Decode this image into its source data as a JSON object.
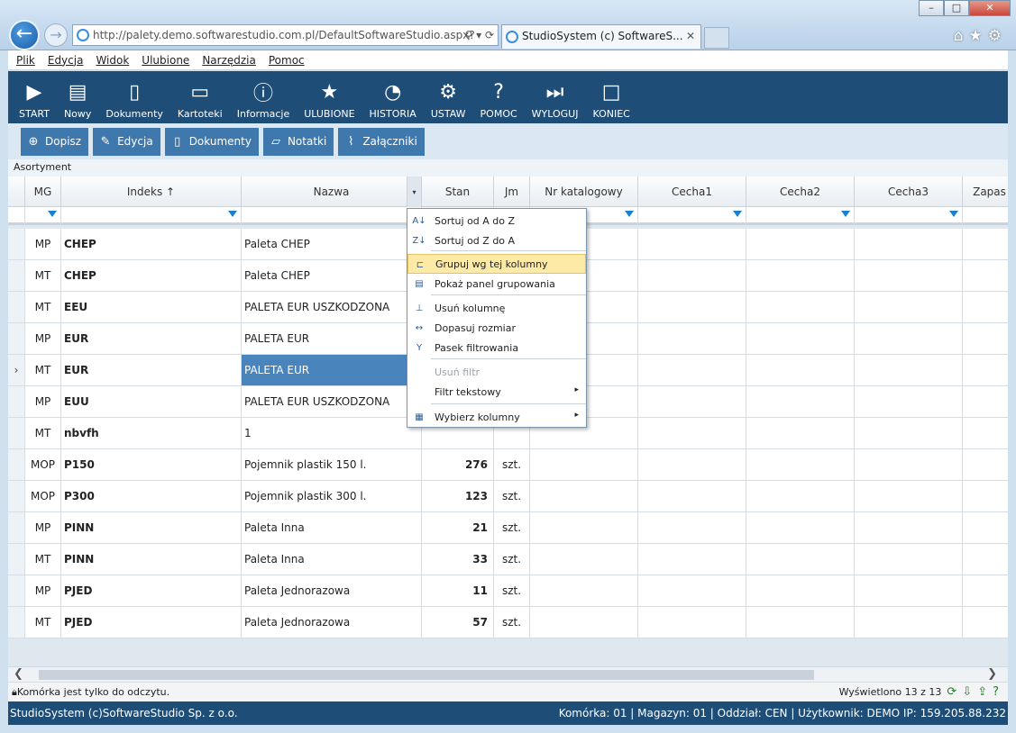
{
  "browser": {
    "url": "http://palety.demo.softwarestudio.com.pl/DefaultSoftwareStudio.aspx?",
    "tab_title": "StudioSystem (c) SoftwareS...",
    "tab_close": "✕"
  },
  "menubar": [
    "Plik",
    "Edycja",
    "Widok",
    "Ulubione",
    "Narzędzia",
    "Pomoc"
  ],
  "toolbar": [
    {
      "label": "START",
      "icon": "play-icon"
    },
    {
      "label": "Nowy",
      "icon": "new-document-icon"
    },
    {
      "label": "Dokumenty",
      "icon": "documents-icon"
    },
    {
      "label": "Kartoteki",
      "icon": "cards-icon"
    },
    {
      "label": "Informacje",
      "icon": "info-icon"
    },
    {
      "label": "ULUBIONE",
      "icon": "star-icon"
    },
    {
      "label": "HISTORIA",
      "icon": "history-icon"
    },
    {
      "label": "USTAW",
      "icon": "gears-icon"
    },
    {
      "label": "POMOC",
      "icon": "help-icon"
    },
    {
      "label": "WYLOGUJ",
      "icon": "logout-icon"
    },
    {
      "label": "KONIEC",
      "icon": "exit-icon"
    }
  ],
  "subtoolbar": [
    {
      "label": "Dopisz",
      "icon": "plus-icon"
    },
    {
      "label": "Edycja",
      "icon": "edit-icon"
    },
    {
      "label": "Dokumenty",
      "icon": "document-icon"
    },
    {
      "label": "Notatki",
      "icon": "note-icon"
    },
    {
      "label": "Załączniki",
      "icon": "paperclip-icon"
    }
  ],
  "section_title": "Asortyment",
  "grid": {
    "columns": [
      "MG",
      "Indeks ↑",
      "Nazwa",
      "Stan",
      "Jm",
      "Nr katalogowy",
      "Cecha1",
      "Cecha2",
      "Cecha3",
      "Zapas"
    ],
    "rows": [
      {
        "mg": "MP",
        "idx": "CHEP",
        "name": "Paleta CHEP",
        "stan": "",
        "jm": ""
      },
      {
        "mg": "MT",
        "idx": "CHEP",
        "name": "Paleta CHEP",
        "stan": "",
        "jm": ""
      },
      {
        "mg": "MT",
        "idx": "EEU",
        "name": "PALETA EUR USZKODZONA",
        "stan": "",
        "jm": ""
      },
      {
        "mg": "MP",
        "idx": "EUR",
        "name": "PALETA EUR",
        "stan": "",
        "jm": ""
      },
      {
        "mg": "MT",
        "idx": "EUR",
        "name": "PALETA EUR",
        "stan": "",
        "jm": "",
        "current": true
      },
      {
        "mg": "MP",
        "idx": "EUU",
        "name": "PALETA EUR USZKODZONA",
        "stan": "",
        "jm": ""
      },
      {
        "mg": "MT",
        "idx": "nbvfh",
        "name": "1",
        "stan": "",
        "jm": ""
      },
      {
        "mg": "MOP",
        "idx": "P150",
        "name": "Pojemnik plastik 150 l.",
        "stan": "276",
        "jm": "szt."
      },
      {
        "mg": "MOP",
        "idx": "P300",
        "name": "Pojemnik plastik 300 l.",
        "stan": "123",
        "jm": "szt."
      },
      {
        "mg": "MP",
        "idx": "PINN",
        "name": "Paleta Inna",
        "stan": "21",
        "jm": "szt."
      },
      {
        "mg": "MT",
        "idx": "PINN",
        "name": "Paleta Inna",
        "stan": "33",
        "jm": "szt."
      },
      {
        "mg": "MP",
        "idx": "PJED",
        "name": "Paleta Jednorazowa",
        "stan": "11",
        "jm": "szt."
      },
      {
        "mg": "MT",
        "idx": "PJED",
        "name": "Paleta Jednorazowa",
        "stan": "57",
        "jm": "szt."
      }
    ]
  },
  "context_menu": {
    "items": [
      {
        "label": "Sortuj od A do Z",
        "icon": "sort-asc-icon"
      },
      {
        "label": "Sortuj od Z do A",
        "icon": "sort-desc-icon"
      },
      {
        "label": "Grupuj wg tej kolumny",
        "icon": "group-icon",
        "highlighted": true
      },
      {
        "label": "Pokaż panel grupowania",
        "icon": "group-panel-icon"
      },
      {
        "label": "Usuń kolumnę",
        "icon": "remove-column-icon"
      },
      {
        "label": "Dopasuj rozmiar",
        "icon": "fit-size-icon"
      },
      {
        "label": "Pasek filtrowania",
        "icon": "filter-bar-icon"
      },
      {
        "label": "Usuń filtr",
        "disabled": true
      },
      {
        "label": "Filtr tekstowy",
        "submenu": true
      },
      {
        "label": "Wybierz kolumny",
        "icon": "choose-columns-icon",
        "submenu": true
      }
    ]
  },
  "status": {
    "left": "Komórka jest tylko do odczytu.",
    "right": "Wyświetlono 13 z 13"
  },
  "footer": {
    "left": "StudioSystem (c)SoftwareStudio Sp. z o.o.",
    "right": "Komórka: 01 | Magazyn: 01 | Oddział: CEN | Użytkownik: DEMO IP: 159.205.88.232"
  }
}
